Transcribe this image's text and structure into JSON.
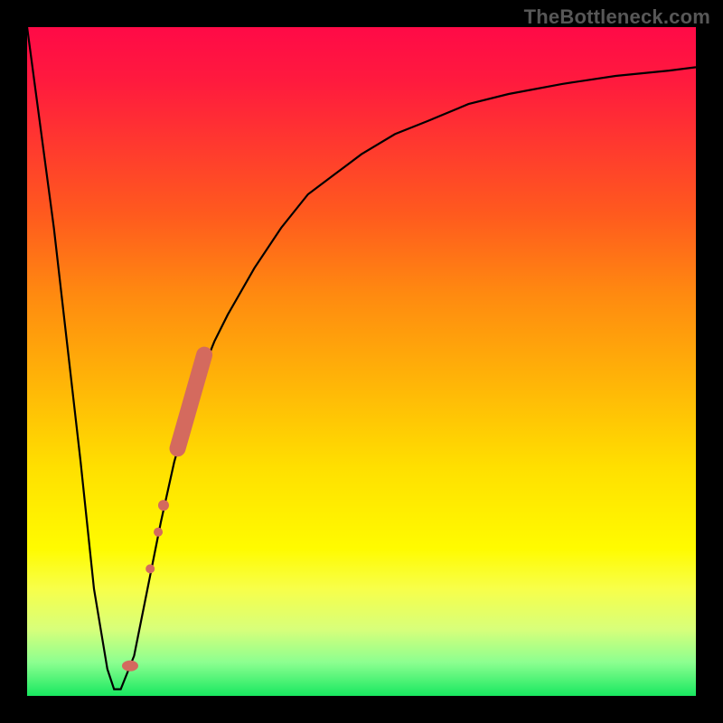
{
  "watermark": "TheBottleneck.com",
  "colors": {
    "frame": "#000000",
    "curve": "#000000",
    "marker": "#d46a5e"
  },
  "chart_data": {
    "type": "line",
    "title": "",
    "xlabel": "",
    "ylabel": "",
    "xlim": [
      0,
      100
    ],
    "ylim": [
      0,
      100
    ],
    "grid": false,
    "series": [
      {
        "name": "bottleneck-curve",
        "x": [
          0,
          4,
          8,
          10,
          12,
          13,
          14,
          16,
          18,
          20,
          22,
          24,
          26,
          28,
          30,
          34,
          38,
          42,
          46,
          50,
          55,
          60,
          66,
          72,
          80,
          88,
          96,
          100
        ],
        "y": [
          100,
          70,
          35,
          16,
          4,
          1,
          1,
          6,
          16,
          26,
          35,
          42,
          48,
          53,
          57,
          64,
          70,
          75,
          78,
          81,
          84,
          86,
          88.5,
          90,
          91.5,
          92.7,
          93.5,
          94
        ]
      }
    ],
    "markers": {
      "pill_segment": {
        "x0": 22.5,
        "y0": 37,
        "x1": 26.5,
        "y1": 51
      },
      "dots": [
        {
          "x": 20.4,
          "y": 28.5,
          "r": 6
        },
        {
          "x": 19.6,
          "y": 24.5,
          "r": 5
        },
        {
          "x": 18.4,
          "y": 19.0,
          "r": 5
        },
        {
          "x": 15.4,
          "y": 4.5,
          "r": 9,
          "ry": 6
        }
      ]
    }
  }
}
